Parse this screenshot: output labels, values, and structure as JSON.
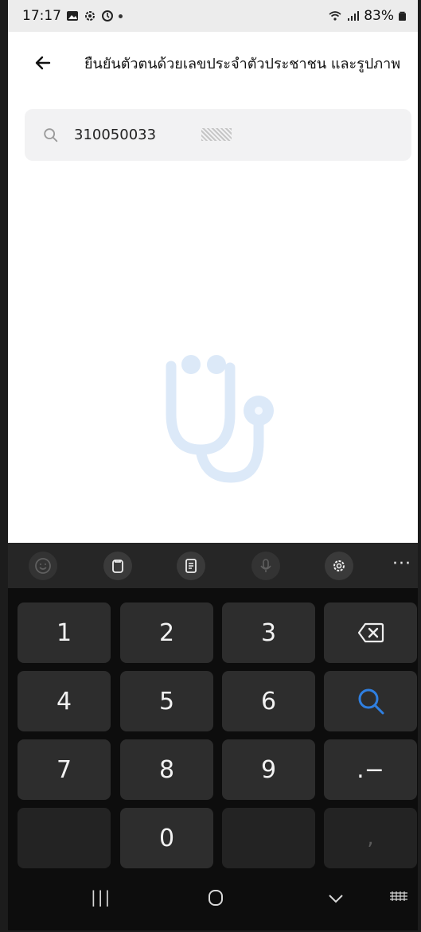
{
  "status_bar": {
    "time": "17:17",
    "battery": "83%",
    "icons": [
      "gallery-icon",
      "settings-icon",
      "alarm-icon",
      "notification-dot",
      "wifi-icon",
      "signal-icon",
      "battery-icon"
    ]
  },
  "header": {
    "back_icon": "arrow-left-icon",
    "title": "ยืนยันตัวตนด้วยเลขประจำตัวประชาชน และรูปภาพ"
  },
  "search": {
    "icon": "search-icon",
    "value": "310050033"
  },
  "illustration": {
    "icon": "stethoscope-icon",
    "color": "#dce9f8"
  },
  "keyboard": {
    "toolbar": [
      "emoji-icon",
      "clipboard-icon",
      "keyboard-mode-icon",
      "microphone-icon",
      "settings-icon"
    ],
    "more_label": "···",
    "keys": {
      "k1": "1",
      "k2": "2",
      "k3": "3",
      "k4": "4",
      "k5": "5",
      "k6": "6",
      "k7": "7",
      "k8": "8",
      "k9": "9",
      "k0": "0",
      "dot_dash": ".−",
      "comma": ","
    },
    "backspace_icon": "backspace-icon",
    "search_key_icon": "search-icon",
    "accent_color": "#2f7fe0"
  },
  "navbar": {
    "recent_label": "|||",
    "home_icon": "home-circle-icon",
    "back_icon": "chevron-down-icon",
    "keyboard_icon": "keyboard-icon"
  }
}
